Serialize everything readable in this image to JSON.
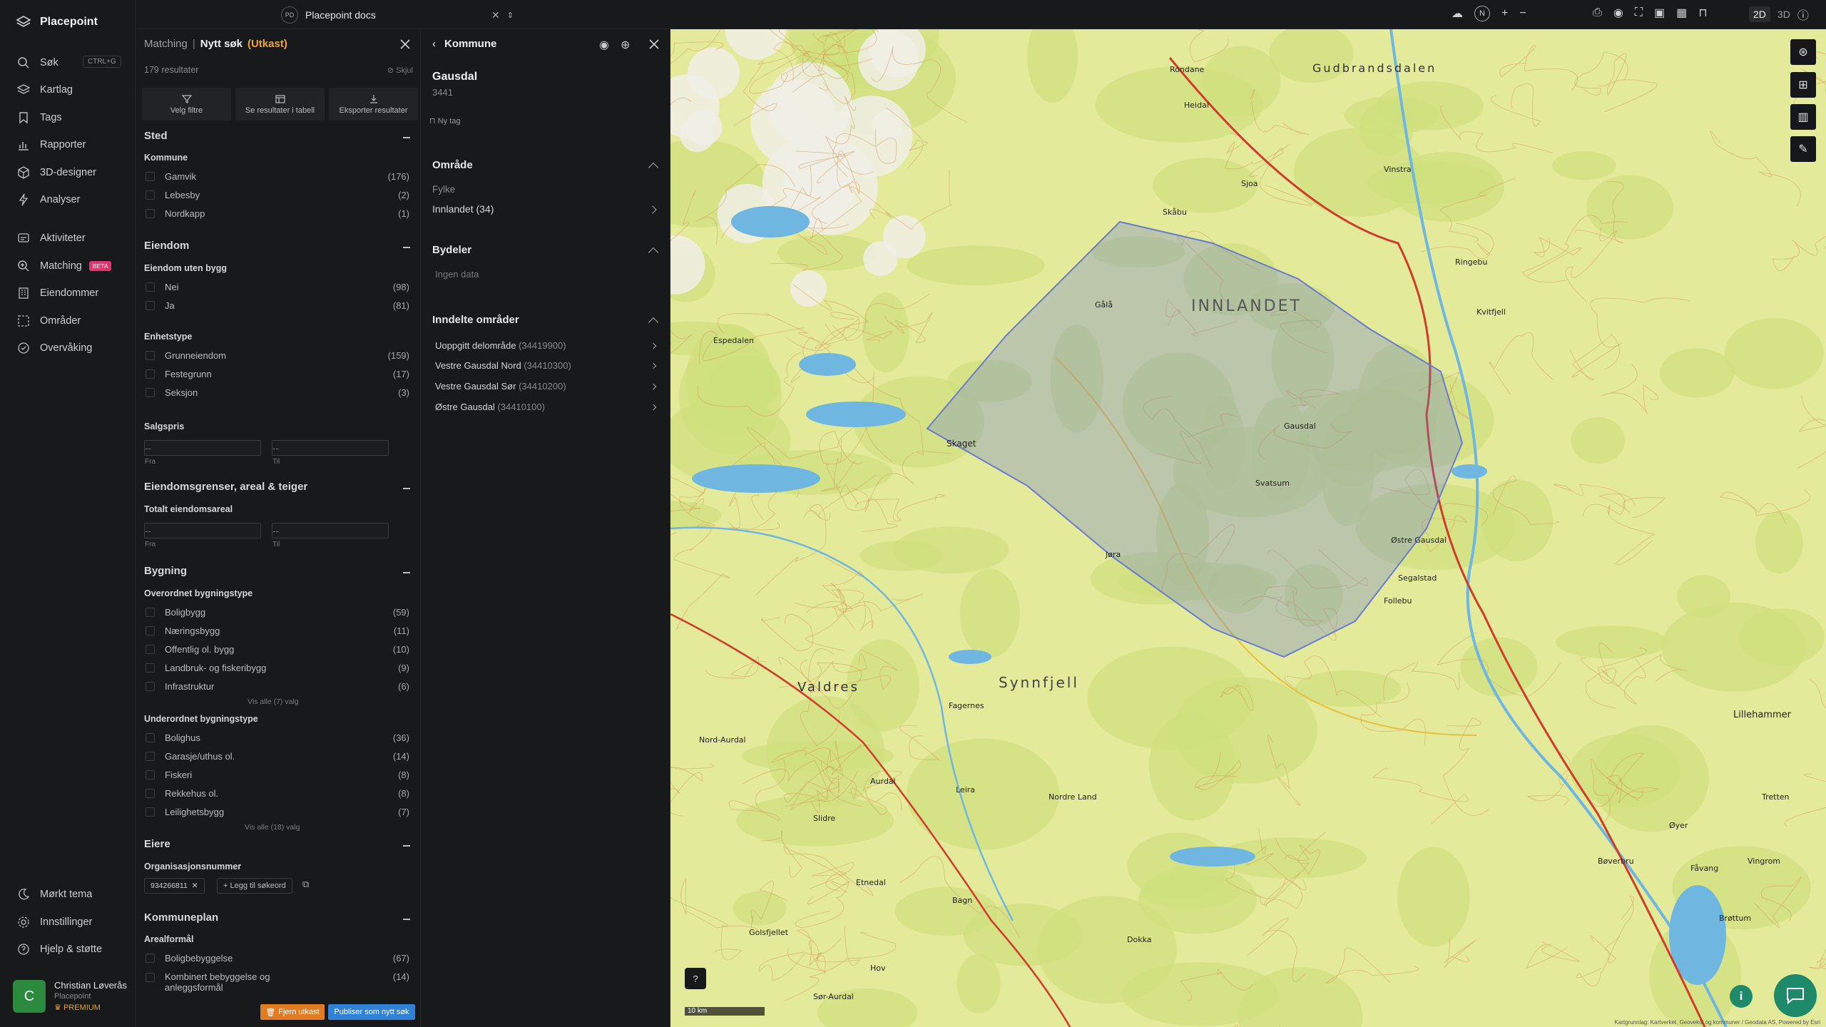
{
  "app": {
    "name": "Placepoint"
  },
  "sidebar": {
    "items": [
      {
        "label": "Søk",
        "icon": "search-icon",
        "shortcut": "CTRL+G"
      },
      {
        "label": "Kartlag",
        "icon": "layers-icon"
      },
      {
        "label": "Tags",
        "icon": "bookmark-icon"
      },
      {
        "label": "Rapporter",
        "icon": "bar-chart-icon"
      },
      {
        "label": "3D-designer",
        "icon": "cube-icon"
      },
      {
        "label": "Analyser",
        "icon": "lightning-icon"
      },
      {
        "label": "Aktiviteter",
        "icon": "activity-icon"
      },
      {
        "label": "Matching",
        "icon": "search-plus-icon",
        "badge": "BETA"
      },
      {
        "label": "Eiendommer",
        "icon": "building-icon"
      },
      {
        "label": "Områder",
        "icon": "area-select-icon"
      },
      {
        "label": "Overvåking",
        "icon": "monitor-icon"
      }
    ],
    "bottom": [
      {
        "label": "Mørkt tema",
        "icon": "moon-icon"
      },
      {
        "label": "Innstillinger",
        "icon": "gear-icon"
      },
      {
        "label": "Hjelp & støtte",
        "icon": "help-icon"
      }
    ],
    "user": {
      "initial": "C",
      "name": "Christian Løverås",
      "org": "Placepoint",
      "plan": "PREMIUM"
    }
  },
  "topbar": {
    "doc_badge": "PD",
    "doc_title": "Placepoint docs",
    "compass": "N",
    "mode_2d": "2D",
    "mode_3d": "3D"
  },
  "search_panel": {
    "crumb_parent": "Matching",
    "crumb_sep": "|",
    "crumb_current": "Nytt søk",
    "crumb_status": "(Utkast)",
    "result_count": "179 resultater",
    "hide_label": "Skjul",
    "actions": [
      "Velg filtre",
      "Se resultater i tabell",
      "Eksporter resultater"
    ],
    "sted": {
      "title": "Sted",
      "kommune_label": "Kommune",
      "items": [
        {
          "label": "Gamvik",
          "count": "(176)"
        },
        {
          "label": "Lebesby",
          "count": "(2)"
        },
        {
          "label": "Nordkapp",
          "count": "(1)"
        }
      ]
    },
    "eiendom": {
      "title": "Eiendom",
      "uten_bygg_label": "Eiendom uten bygg",
      "uten_bygg": [
        {
          "label": "Nei",
          "count": "(98)"
        },
        {
          "label": "Ja",
          "count": "(81)"
        }
      ],
      "enhetstype_label": "Enhetstype",
      "enhetstype": [
        {
          "label": "Grunneiendom",
          "count": "(159)"
        },
        {
          "label": "Festegrunn",
          "count": "(17)"
        },
        {
          "label": "Seksjon",
          "count": "(3)"
        }
      ],
      "salgspris_label": "Salgspris",
      "from_label": "Fra",
      "to_label": "Til",
      "placeholder": "--"
    },
    "grenser": {
      "title": "Eiendomsgrenser, areal & teiger",
      "areal_label": "Totalt eiendomsareal",
      "from_label": "Fra",
      "to_label": "Til",
      "placeholder": "--"
    },
    "bygning": {
      "title": "Bygning",
      "overordnet_label": "Overordnet bygningstype",
      "overordnet": [
        {
          "label": "Boligbygg",
          "count": "(59)"
        },
        {
          "label": "Næringsbygg",
          "count": "(11)"
        },
        {
          "label": "Offentlig ol. bygg",
          "count": "(10)"
        },
        {
          "label": "Landbruk- og fiskeribygg",
          "count": "(9)"
        },
        {
          "label": "Infrastruktur",
          "count": "(6)"
        }
      ],
      "overordnet_more": "Vis alle (7) valg",
      "underordnet_label": "Underordnet bygningstype",
      "underordnet": [
        {
          "label": "Bolighus",
          "count": "(36)"
        },
        {
          "label": "Garasje/uthus ol.",
          "count": "(14)"
        },
        {
          "label": "Fiskeri",
          "count": "(8)"
        },
        {
          "label": "Rekkehus ol.",
          "count": "(8)"
        },
        {
          "label": "Leilighetsbygg",
          "count": "(7)"
        }
      ],
      "underordnet_more": "Vis alle (18) valg"
    },
    "eiere": {
      "title": "Eiere",
      "org_label": "Organisasjonsnummer",
      "chip": "934266811",
      "add_label": "Legg til søkeord"
    },
    "kommuneplan": {
      "title": "Kommuneplan",
      "areal_label": "Arealformål",
      "items": [
        {
          "label": "Boligbebyggelse",
          "count": "(67)"
        },
        {
          "label": "Kombinert bebyggelse og anleggsformål",
          "count": "(14)"
        }
      ]
    },
    "remove_btn": "Fjern utkast",
    "publish_btn": "Publiser som nytt søk"
  },
  "kommune_panel": {
    "title": "Kommune",
    "name": "Gausdal",
    "code": "3441",
    "new_tag": "Ny tag",
    "omrade_title": "Område",
    "fylke_label": "Fylke",
    "fylke_value": "Innlandet (34)",
    "bydeler_title": "Bydeler",
    "bydeler_empty": "Ingen data",
    "inndelte_title": "Inndelte områder",
    "inndelte": [
      {
        "label": "Uoppgitt delområde",
        "code": "(34419900)"
      },
      {
        "label": "Vestre Gausdal Nord",
        "code": "(34410300)"
      },
      {
        "label": "Vestre Gausdal Sør",
        "code": "(34410200)"
      },
      {
        "label": "Østre Gausdal",
        "code": "(34410100)"
      }
    ]
  },
  "map": {
    "labels": [
      "INNLANDET",
      "Synnfjell",
      "Valdres",
      "Gudbrandsdalen",
      "Skaget",
      "Lillehammer",
      "Fagernes",
      "Gålå",
      "Svatsum",
      "Follebu",
      "Segalstad",
      "Jøra",
      "Østre Gausdal",
      "Vingrom",
      "Bagn",
      "Dokka",
      "Hov",
      "Aurdal",
      "Espedalen",
      "Vinstra",
      "Ringebu",
      "Fåvang",
      "Tretten",
      "Øyer",
      "Heidal",
      "Sjoa",
      "Skåbu",
      "Rondane",
      "Kvitfjell",
      "Gausdal",
      "Leira",
      "Golsfjellet",
      "Slidre",
      "Bøverbru",
      "Brøttum",
      "Nordre Land",
      "Sør-Aurdal",
      "Nord-Aurdal",
      "Etnedal"
    ],
    "scale": "10 km",
    "attribution": "Kartgrunnlag: Kartverket, Geovekst og kommuner / Geodata AS, Powered by Esri",
    "colors": {
      "terrain": "#e3ea9a",
      "forest": "#cfe07d",
      "water": "#6fb6e0",
      "contour": "#d69a58",
      "road": "#d23a2a",
      "region": "#6a7ccd"
    }
  },
  "theme": {
    "accent": "#f0a330",
    "publish": "#2f82d6",
    "remove": "#e07b1f",
    "beta": "#e0346e"
  }
}
